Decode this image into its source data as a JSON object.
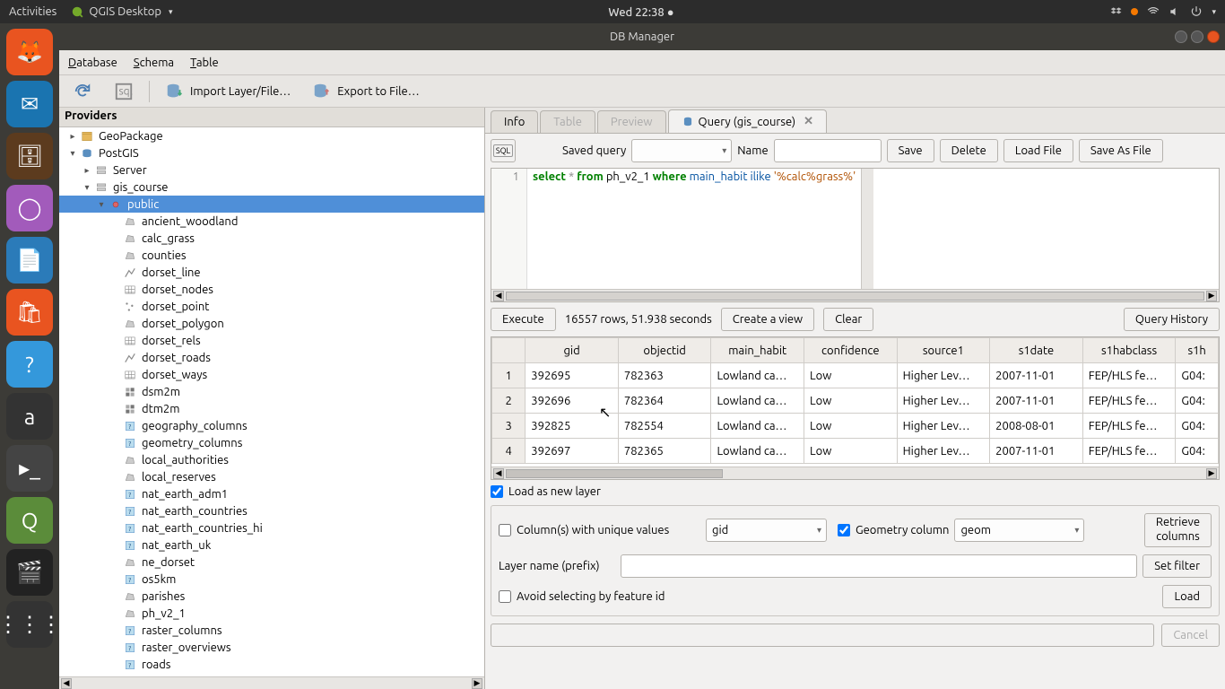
{
  "gnome": {
    "activities": "Activities",
    "app_name": "QGIS Desktop",
    "clock": "Wed 22:38"
  },
  "window": {
    "title": "DB Manager"
  },
  "menubar": {
    "database": "Database",
    "schema": "Schema",
    "table": "Table"
  },
  "toolbar": {
    "import": "Import Layer/File…",
    "export": "Export to File…"
  },
  "providers": {
    "title": "Providers",
    "geopackage": "GeoPackage",
    "postgis": "PostGIS",
    "server": "Server",
    "gis_course": "gis_course",
    "public": "public",
    "layers": [
      "ancient_woodland",
      "calc_grass",
      "counties",
      "dorset_line",
      "dorset_nodes",
      "dorset_point",
      "dorset_polygon",
      "dorset_rels",
      "dorset_roads",
      "dorset_ways",
      "dsm2m",
      "dtm2m",
      "geography_columns",
      "geometry_columns",
      "local_authorities",
      "local_reserves",
      "nat_earth_adm1",
      "nat_earth_countries",
      "nat_earth_countries_hi",
      "nat_earth_uk",
      "ne_dorset",
      "os5km",
      "parishes",
      "ph_v2_1",
      "raster_columns",
      "raster_overviews",
      "roads"
    ]
  },
  "tabs": {
    "info": "Info",
    "table": "Table",
    "preview": "Preview",
    "query": "Query (gis_course)"
  },
  "queryrow": {
    "saved_query": "Saved query",
    "name": "Name",
    "save": "Save",
    "delete": "Delete",
    "load_file": "Load File",
    "save_as_file": "Save As File"
  },
  "sql": {
    "line": "1",
    "select": "select",
    "star": "*",
    "from": "from",
    "tbl": "ph_v2_1",
    "where": "where",
    "col": "main_habit",
    "ilike": "ilike",
    "lit": "'%calc%grass%'"
  },
  "exec": {
    "execute": "Execute",
    "status": "16557 rows, 51.938 seconds",
    "create_view": "Create a view",
    "clear": "Clear",
    "history": "Query History"
  },
  "results": {
    "headers": [
      "gid",
      "objectid",
      "main_habit",
      "confidence",
      "source1",
      "s1date",
      "s1habclass",
      "s1h"
    ],
    "rows": [
      {
        "n": "1",
        "gid": "392695",
        "objectid": "782363",
        "main_habit": "Lowland ca…",
        "confidence": "Low",
        "source1": "Higher Lev…",
        "s1date": "2007-11-01",
        "s1habclass": "FEP/HLS fe…",
        "s1h": "G04: "
      },
      {
        "n": "2",
        "gid": "392696",
        "objectid": "782364",
        "main_habit": "Lowland ca…",
        "confidence": "Low",
        "source1": "Higher Lev…",
        "s1date": "2007-11-01",
        "s1habclass": "FEP/HLS fe…",
        "s1h": "G04: "
      },
      {
        "n": "3",
        "gid": "392825",
        "objectid": "782554",
        "main_habit": "Lowland ca…",
        "confidence": "Low",
        "source1": "Higher Lev…",
        "s1date": "2008-08-01",
        "s1habclass": "FEP/HLS fe…",
        "s1h": "G04: "
      },
      {
        "n": "4",
        "gid": "392697",
        "objectid": "782365",
        "main_habit": "Lowland ca…",
        "confidence": "Low",
        "source1": "Higher Lev…",
        "s1date": "2007-11-01",
        "s1habclass": "FEP/HLS fe…",
        "s1h": "G04: "
      }
    ]
  },
  "layer": {
    "load_new": "Load as new layer",
    "col_unique": "Column(s) with unique values",
    "col_unique_val": "gid",
    "geom_col": "Geometry column",
    "geom_col_val": "geom",
    "retrieve": "Retrieve columns",
    "layer_name": "Layer name (prefix)",
    "set_filter": "Set filter",
    "avoid": "Avoid selecting by feature id",
    "load": "Load",
    "cancel": "Cancel"
  },
  "launcher_colors": [
    "#e95420",
    "#1a74b0",
    "#5c3b1e",
    "#a25bbb",
    "#2b7bb9",
    "#e95420",
    "#3498db",
    "#333",
    "#7f8c8d",
    "#5b8c3a",
    "#222",
    "#333"
  ]
}
